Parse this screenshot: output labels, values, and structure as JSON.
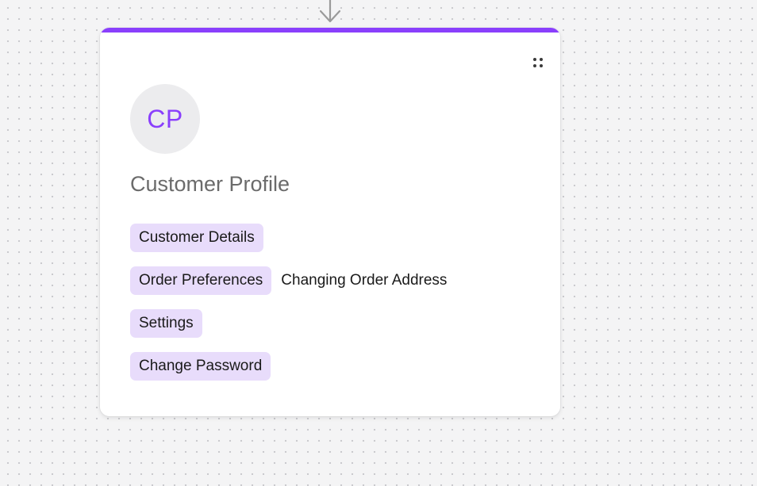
{
  "card": {
    "accent_color": "#8a3ffc",
    "avatar_initials": "CP",
    "title": "Customer Profile",
    "rows": [
      {
        "tag": "Customer Details"
      },
      {
        "tag": "Order Preferences",
        "extra": "Changing Order Address"
      },
      {
        "tag": "Settings"
      },
      {
        "tag": "Change Password"
      }
    ],
    "handle_icon": "drag-dots-icon"
  },
  "connector_icon": "arrow-down-icon",
  "tag_color": "#e8dcfb"
}
